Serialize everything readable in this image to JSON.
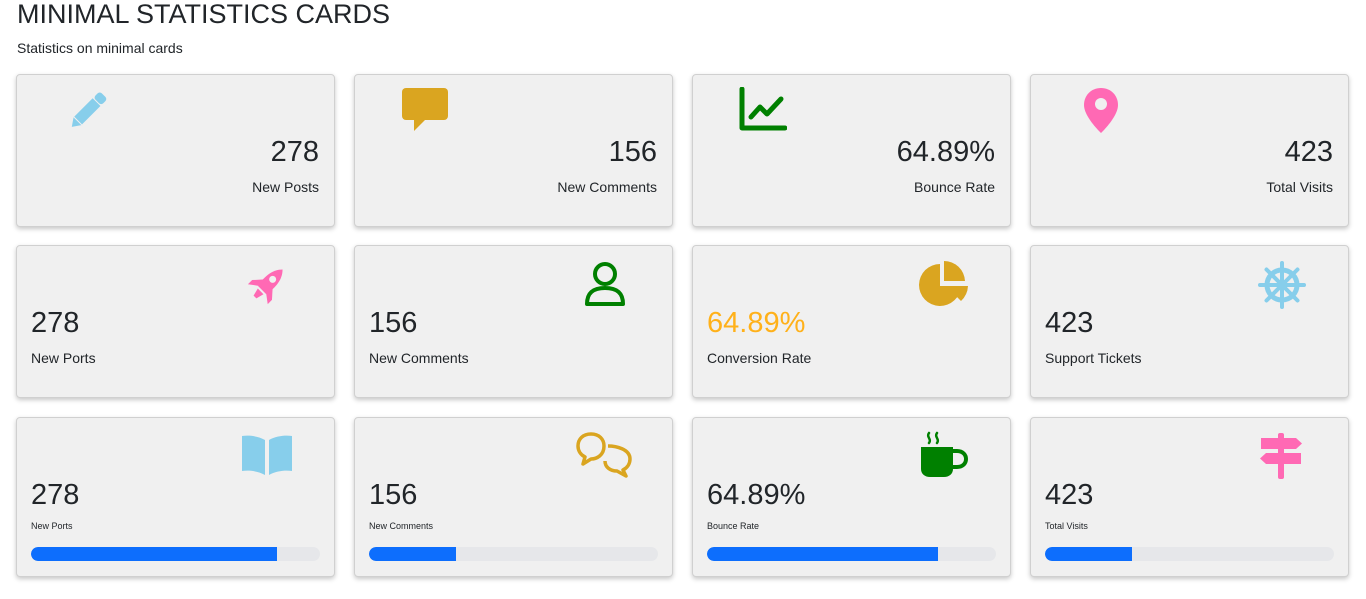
{
  "header": {
    "title": "MINIMAL STATISTICS CARDS",
    "subtitle": "Statistics on minimal cards"
  },
  "row1": [
    {
      "value": "278",
      "label": "New Posts",
      "icon": "pencil-icon",
      "icon_color": "#87ceeb"
    },
    {
      "value": "156",
      "label": "New Comments",
      "icon": "comment-icon",
      "icon_color": "#daa520"
    },
    {
      "value": "64.89%",
      "label": "Bounce Rate",
      "icon": "line-chart-icon",
      "icon_color": "#008000"
    },
    {
      "value": "423",
      "label": "Total Visits",
      "icon": "map-pin-icon",
      "icon_color": "#ff69b4"
    }
  ],
  "row2": [
    {
      "value": "278",
      "label": "New Ports",
      "icon": "rocket-icon",
      "icon_color": "#ff69b4"
    },
    {
      "value": "156",
      "label": "New Comments",
      "icon": "user-icon",
      "icon_color": "#008000"
    },
    {
      "value": "64.89%",
      "label": "Conversion Rate",
      "icon": "pie-chart-icon",
      "icon_color": "#daa520",
      "value_color": "#ffb11a"
    },
    {
      "value": "423",
      "label": "Support Tickets",
      "icon": "helm-icon",
      "icon_color": "#87ceeb"
    }
  ],
  "row3": [
    {
      "value": "278",
      "label": "New Ports",
      "icon": "book-icon",
      "icon_color": "#87ceeb",
      "progress": 0.85
    },
    {
      "value": "156",
      "label": "New Comments",
      "icon": "comments-icon",
      "icon_color": "#daa520",
      "progress": 0.3
    },
    {
      "value": "64.89%",
      "label": "Bounce Rate",
      "icon": "coffee-icon",
      "icon_color": "#008000",
      "progress": 0.8
    },
    {
      "value": "423",
      "label": "Total Visits",
      "icon": "signpost-icon",
      "icon_color": "#ff69b4",
      "progress": 0.3
    }
  ],
  "progress_color": "#0d6efd"
}
